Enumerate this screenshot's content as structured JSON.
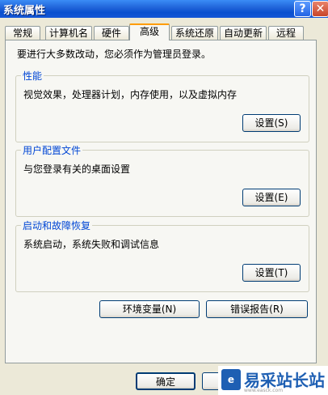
{
  "window": {
    "title": "系统属性"
  },
  "titlebar_buttons": {
    "help": "?",
    "close": "✕"
  },
  "tabs": [
    {
      "label": "常规"
    },
    {
      "label": "计算机名"
    },
    {
      "label": "硬件"
    },
    {
      "label": "高级",
      "active": true
    },
    {
      "label": "系统还原"
    },
    {
      "label": "自动更新"
    },
    {
      "label": "远程"
    }
  ],
  "intro": "要进行大多数改动，您必须作为管理员登录。",
  "groups": {
    "performance": {
      "title": "性能",
      "desc": "视觉效果，处理器计划，内存使用，以及虚拟内存",
      "button": "设置(S)"
    },
    "profiles": {
      "title": "用户配置文件",
      "desc": "与您登录有关的桌面设置",
      "button": "设置(E)"
    },
    "startup": {
      "title": "启动和故障恢复",
      "desc": "系统启动，系统失败和调试信息",
      "button": "设置(T)"
    }
  },
  "env_button": "环境变量(N)",
  "error_button": "错误报告(R)",
  "ok_button": "确定",
  "watermark": {
    "text": "易采站长站",
    "url": "www.easck.com",
    "logo": "e"
  }
}
